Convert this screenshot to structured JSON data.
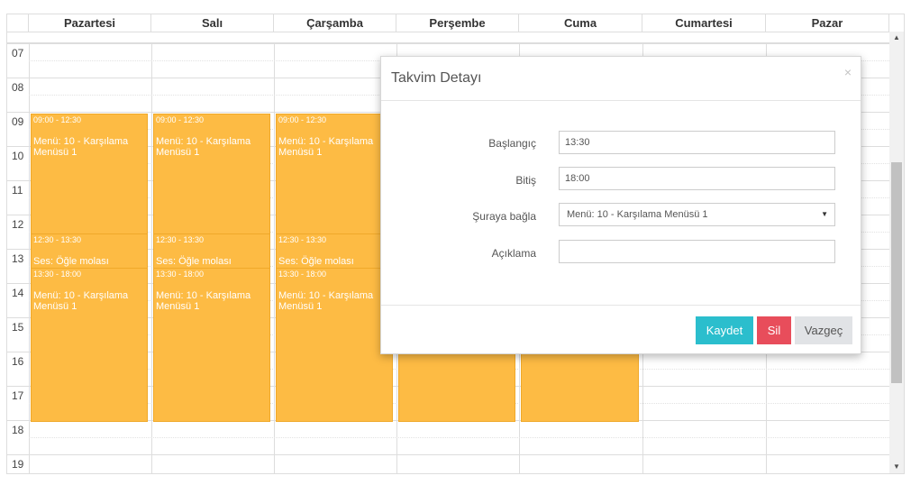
{
  "calendar": {
    "days": [
      "Pazartesi",
      "Salı",
      "Çarşamba",
      "Perşembe",
      "Cuma",
      "Cumartesi",
      "Pazar"
    ],
    "hours": [
      "07",
      "08",
      "09",
      "10",
      "11",
      "12",
      "13",
      "14",
      "15",
      "16",
      "17",
      "18",
      "19"
    ],
    "events": {
      "e1": {
        "time": "09:00 - 12:30",
        "title": "Menü: 10 - Karşılama Menüsü 1"
      },
      "e2": {
        "time": "12:30 - 13:30",
        "title": "Ses: Öğle molası"
      },
      "e3": {
        "time": "13:30 - 18:00",
        "title": "Menü: 10 - Karşılama Menüsü 1"
      }
    }
  },
  "modal": {
    "title": "Takvim Detayı",
    "close_glyph": "×",
    "fields": {
      "start": {
        "label": "Başlangıç",
        "value": "13:30"
      },
      "end": {
        "label": "Bitiş",
        "value": "18:00"
      },
      "link": {
        "label": "Şuraya bağla",
        "value": "Menü: 10 - Karşılama Menüsü 1"
      },
      "description": {
        "label": "Açıklama",
        "value": ""
      }
    },
    "buttons": {
      "save": "Kaydet",
      "delete": "Sil",
      "cancel": "Vazgeç"
    }
  },
  "colors": {
    "event": "#FDBB44",
    "save": "#2BBECD",
    "delete": "#E84D5B",
    "cancel": "#e1e3e6"
  },
  "icons": {
    "close": "close-icon",
    "select_caret": "caret-down-icon",
    "scroll_up": "arrow-up-icon",
    "scroll_down": "arrow-down-icon"
  }
}
